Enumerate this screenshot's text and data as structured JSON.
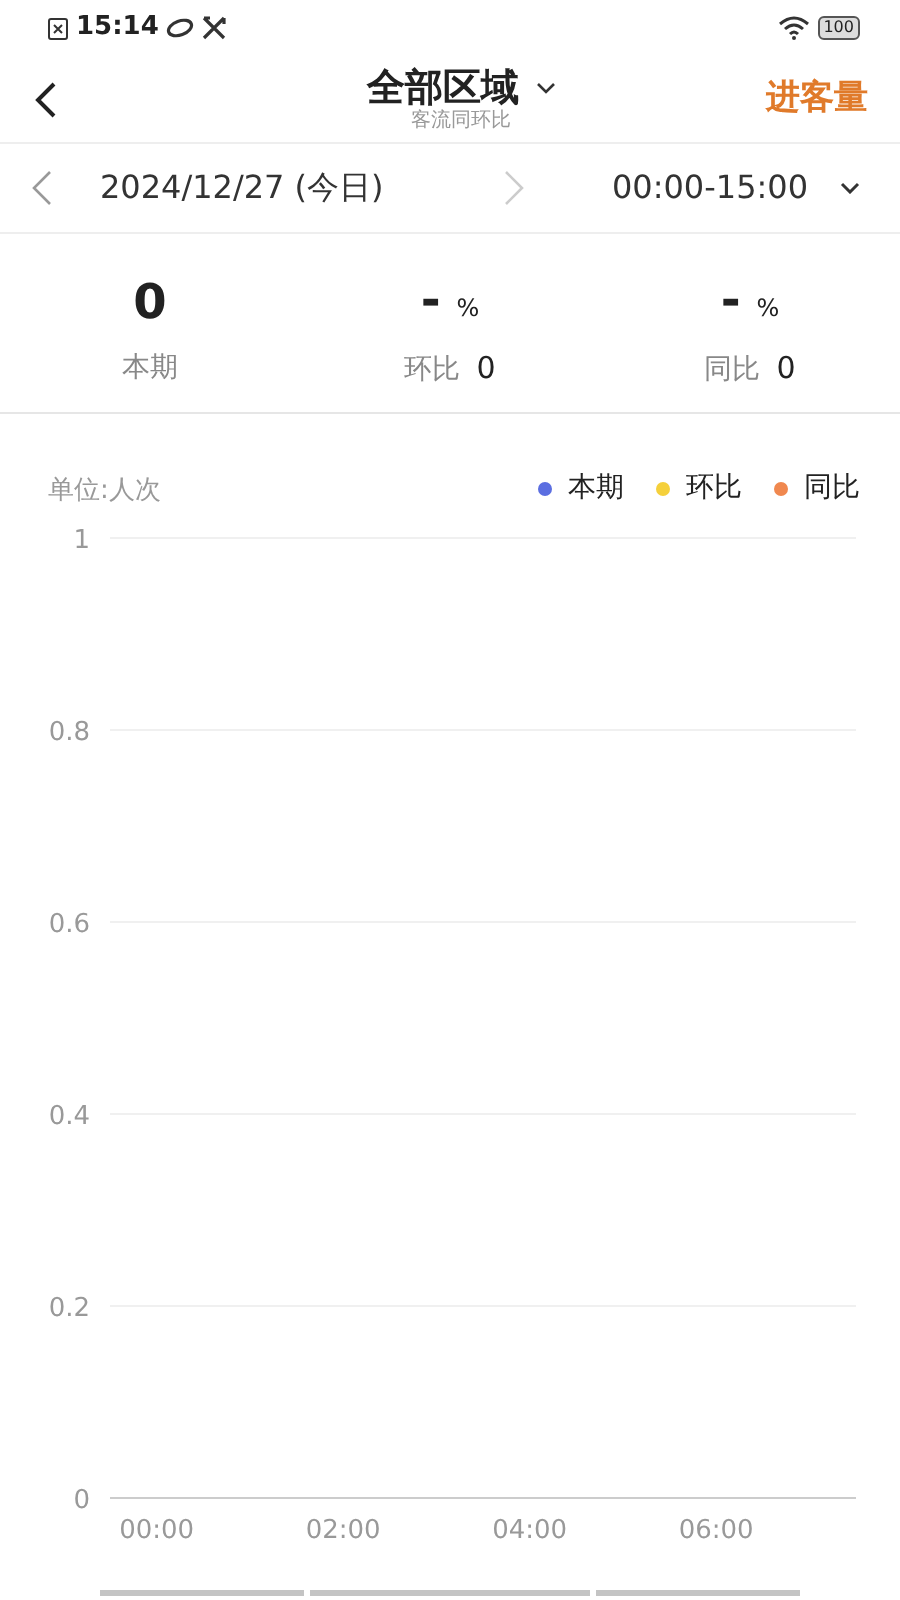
{
  "status_bar": {
    "time": "15:14",
    "battery": "100"
  },
  "header": {
    "title": "全部区域",
    "subtitle": "客流同环比",
    "action": "进客量"
  },
  "date_bar": {
    "date": "2024/12/27 (今日)",
    "time_range": "00:00-15:00",
    "next_disabled": true
  },
  "stats": [
    {
      "value": "0",
      "label": "本期"
    },
    {
      "value": "-",
      "unit": "%",
      "label": "环比",
      "extra": "0"
    },
    {
      "value": "-",
      "unit": "%",
      "label": "同比",
      "extra": "0"
    }
  ],
  "chart": {
    "unit_label": "单位:人次",
    "chart_data": {
      "type": "line",
      "categories": [
        "00:00",
        "02:00",
        "04:00",
        "06:00"
      ],
      "series": [
        {
          "name": "本期",
          "color": "#5b6ee1",
          "values": [
            null,
            null,
            null,
            null
          ]
        },
        {
          "name": "环比",
          "color": "#f5d03b",
          "values": [
            null,
            null,
            null,
            null
          ]
        },
        {
          "name": "同比",
          "color": "#f0884f",
          "values": [
            null,
            null,
            null,
            null
          ]
        }
      ],
      "grid": true,
      "ylim": [
        0,
        1
      ],
      "yticks": [
        {
          "value": 0,
          "label": "0"
        },
        {
          "value": 0.2,
          "label": "0.2"
        },
        {
          "value": 0.4,
          "label": "0.4"
        },
        {
          "value": 0.6,
          "label": "0.6"
        },
        {
          "value": 0.8,
          "label": "0.8"
        },
        {
          "value": 1,
          "label": "1"
        }
      ]
    }
  }
}
